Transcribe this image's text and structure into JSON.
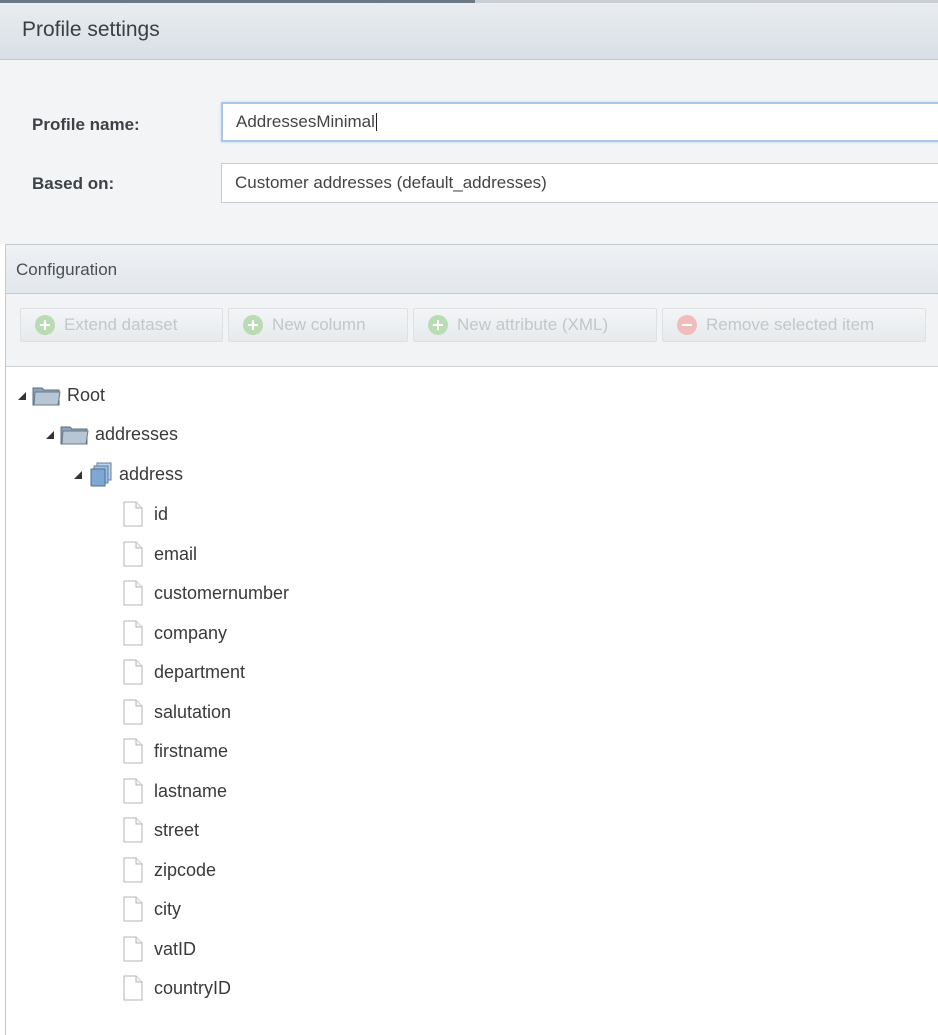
{
  "header": {
    "title": "Profile settings"
  },
  "form": {
    "profile_name_label": "Profile name:",
    "profile_name_value": "AddressesMinimal",
    "based_on_label": "Based on:",
    "based_on_value": "Customer addresses (default_addresses)"
  },
  "config": {
    "title": "Configuration",
    "toolbar": {
      "extend_dataset": "Extend dataset",
      "new_column": "New column",
      "new_attribute": "New attribute (XML)",
      "remove_selected": "Remove selected item"
    },
    "tree": {
      "root": "Root",
      "addresses": "addresses",
      "address": "address",
      "fields": [
        "id",
        "email",
        "customernumber",
        "company",
        "department",
        "salutation",
        "firstname",
        "lastname",
        "street",
        "zipcode",
        "city",
        "vatID",
        "countryID"
      ]
    }
  },
  "icons": {
    "root": "folder-icon",
    "addresses": "folder-icon",
    "address": "stacked-pages-icon",
    "field": "file-icon",
    "extend": "plus-circle-icon",
    "remove": "minus-circle-icon"
  },
  "colors": {
    "plus_icon": "#b9dcb4",
    "minus_icon": "#f1bcbc",
    "focus_border": "#a8c8e8"
  }
}
